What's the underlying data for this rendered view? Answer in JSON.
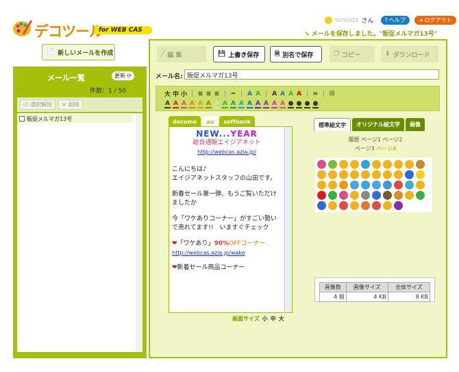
{
  "header": {
    "brand": "デコツール",
    "brand_sub": "for WEB CAS",
    "user_suffix": "さん",
    "help": "ヘルプ",
    "logout": "ログアウト",
    "save_message": "メールを保存しました。\"販促メルマガ13号\""
  },
  "sidebar": {
    "new_mail": "新しいメールを作成",
    "title": "メール一覧",
    "update": "更新",
    "count": "件数：1 / 50",
    "deselect": "選択解除",
    "delete": "削除",
    "items": [
      {
        "label": "販促メルマガ13号"
      }
    ]
  },
  "toolbar": {
    "edit": "編 集",
    "overwrite": "上書き保存",
    "save_as": "別名で保存",
    "copy": "コピー",
    "download": "ダウンロード"
  },
  "editor": {
    "name_label": "メール名:",
    "name_value": "販促メルマガ13号",
    "format_row1": [
      "大",
      "中",
      "小",
      "|",
      "≡",
      "≡",
      "≡",
      "|",
      "━",
      "|",
      "A",
      "A",
      "|",
      "A",
      "A",
      "A",
      "A",
      "|",
      "∞",
      "|",
      "☒"
    ],
    "format_row2_count": 19
  },
  "carriers": [
    "docomo",
    "au",
    "softbank"
  ],
  "preview": {
    "banner_new": "NEW...",
    "banner_year": "YEAR",
    "company": "総合通販エイジアネット",
    "link1": "http://webcas.azia.jp/",
    "greeting": "こんにちは♪",
    "staff": "エイジアネットスタッフの山田です。",
    "sale": "新春セール第一弾、もうご覧いただけましたか",
    "corner": "今「ワケありコーナー」がすごい勢いで売れてます!!　いますぐチェック",
    "wake_label": "「ワケあり」",
    "wake_off": "90%",
    "wake_tail": "OFFコーナー",
    "link2": "http://webcas.azia.jp/wake",
    "new_item": "新着セール商品コーナー"
  },
  "screen_size": {
    "label": "画面サイズ",
    "small": "小",
    "medium": "中",
    "large": "大"
  },
  "emoji_panel": {
    "tabs": [
      "標準絵文字",
      "オリジナル絵文字",
      "画像"
    ],
    "history": "履歴",
    "page1": "ページ1",
    "page2": "ページ2",
    "page3": "ページ3",
    "page4": "ページ4",
    "colors": [
      "#e04a8a",
      "#7ab93a",
      "#f2b21a",
      "#f2b21a",
      "#2aa6e0",
      "#f2b21a",
      "#f2b21a",
      "#f2b21a",
      "#f2b21a",
      "#c98a2a",
      "#f2b21a",
      "#f2b21a",
      "#f2b21a",
      "#f2b21a",
      "#f2b21a",
      "#f2b21a",
      "#f2b21a",
      "#f2b21a",
      "#2a6ad6",
      "#f2d21a",
      "#f2b21a",
      "#f2b21a",
      "#e0a01a",
      "#4aa6e0",
      "#3aa6d6",
      "#4aa6e0",
      "#3a9ad6",
      "#e04a4a",
      "#3ab0d0",
      "#f2b21a",
      "#e01a1a",
      "#3ab03a",
      "#e04a8a",
      "#f2b21a",
      "#8a8a8a",
      "#3a6ad6",
      "#7a5a2a",
      "#e08a2a",
      "#f2b21a",
      "#3ab03a",
      "#2a6ad6",
      "#f2b21a",
      "#e04a4a",
      "#f2b21a",
      "#e07a2a",
      "#e04a4a",
      "#f2b21a",
      "#8a2aa6"
    ]
  },
  "stats": {
    "headers": [
      "画像数",
      "画像サイズ",
      "全体サイズ"
    ],
    "values": [
      "4 個",
      "4 KB",
      "8 KB"
    ]
  }
}
